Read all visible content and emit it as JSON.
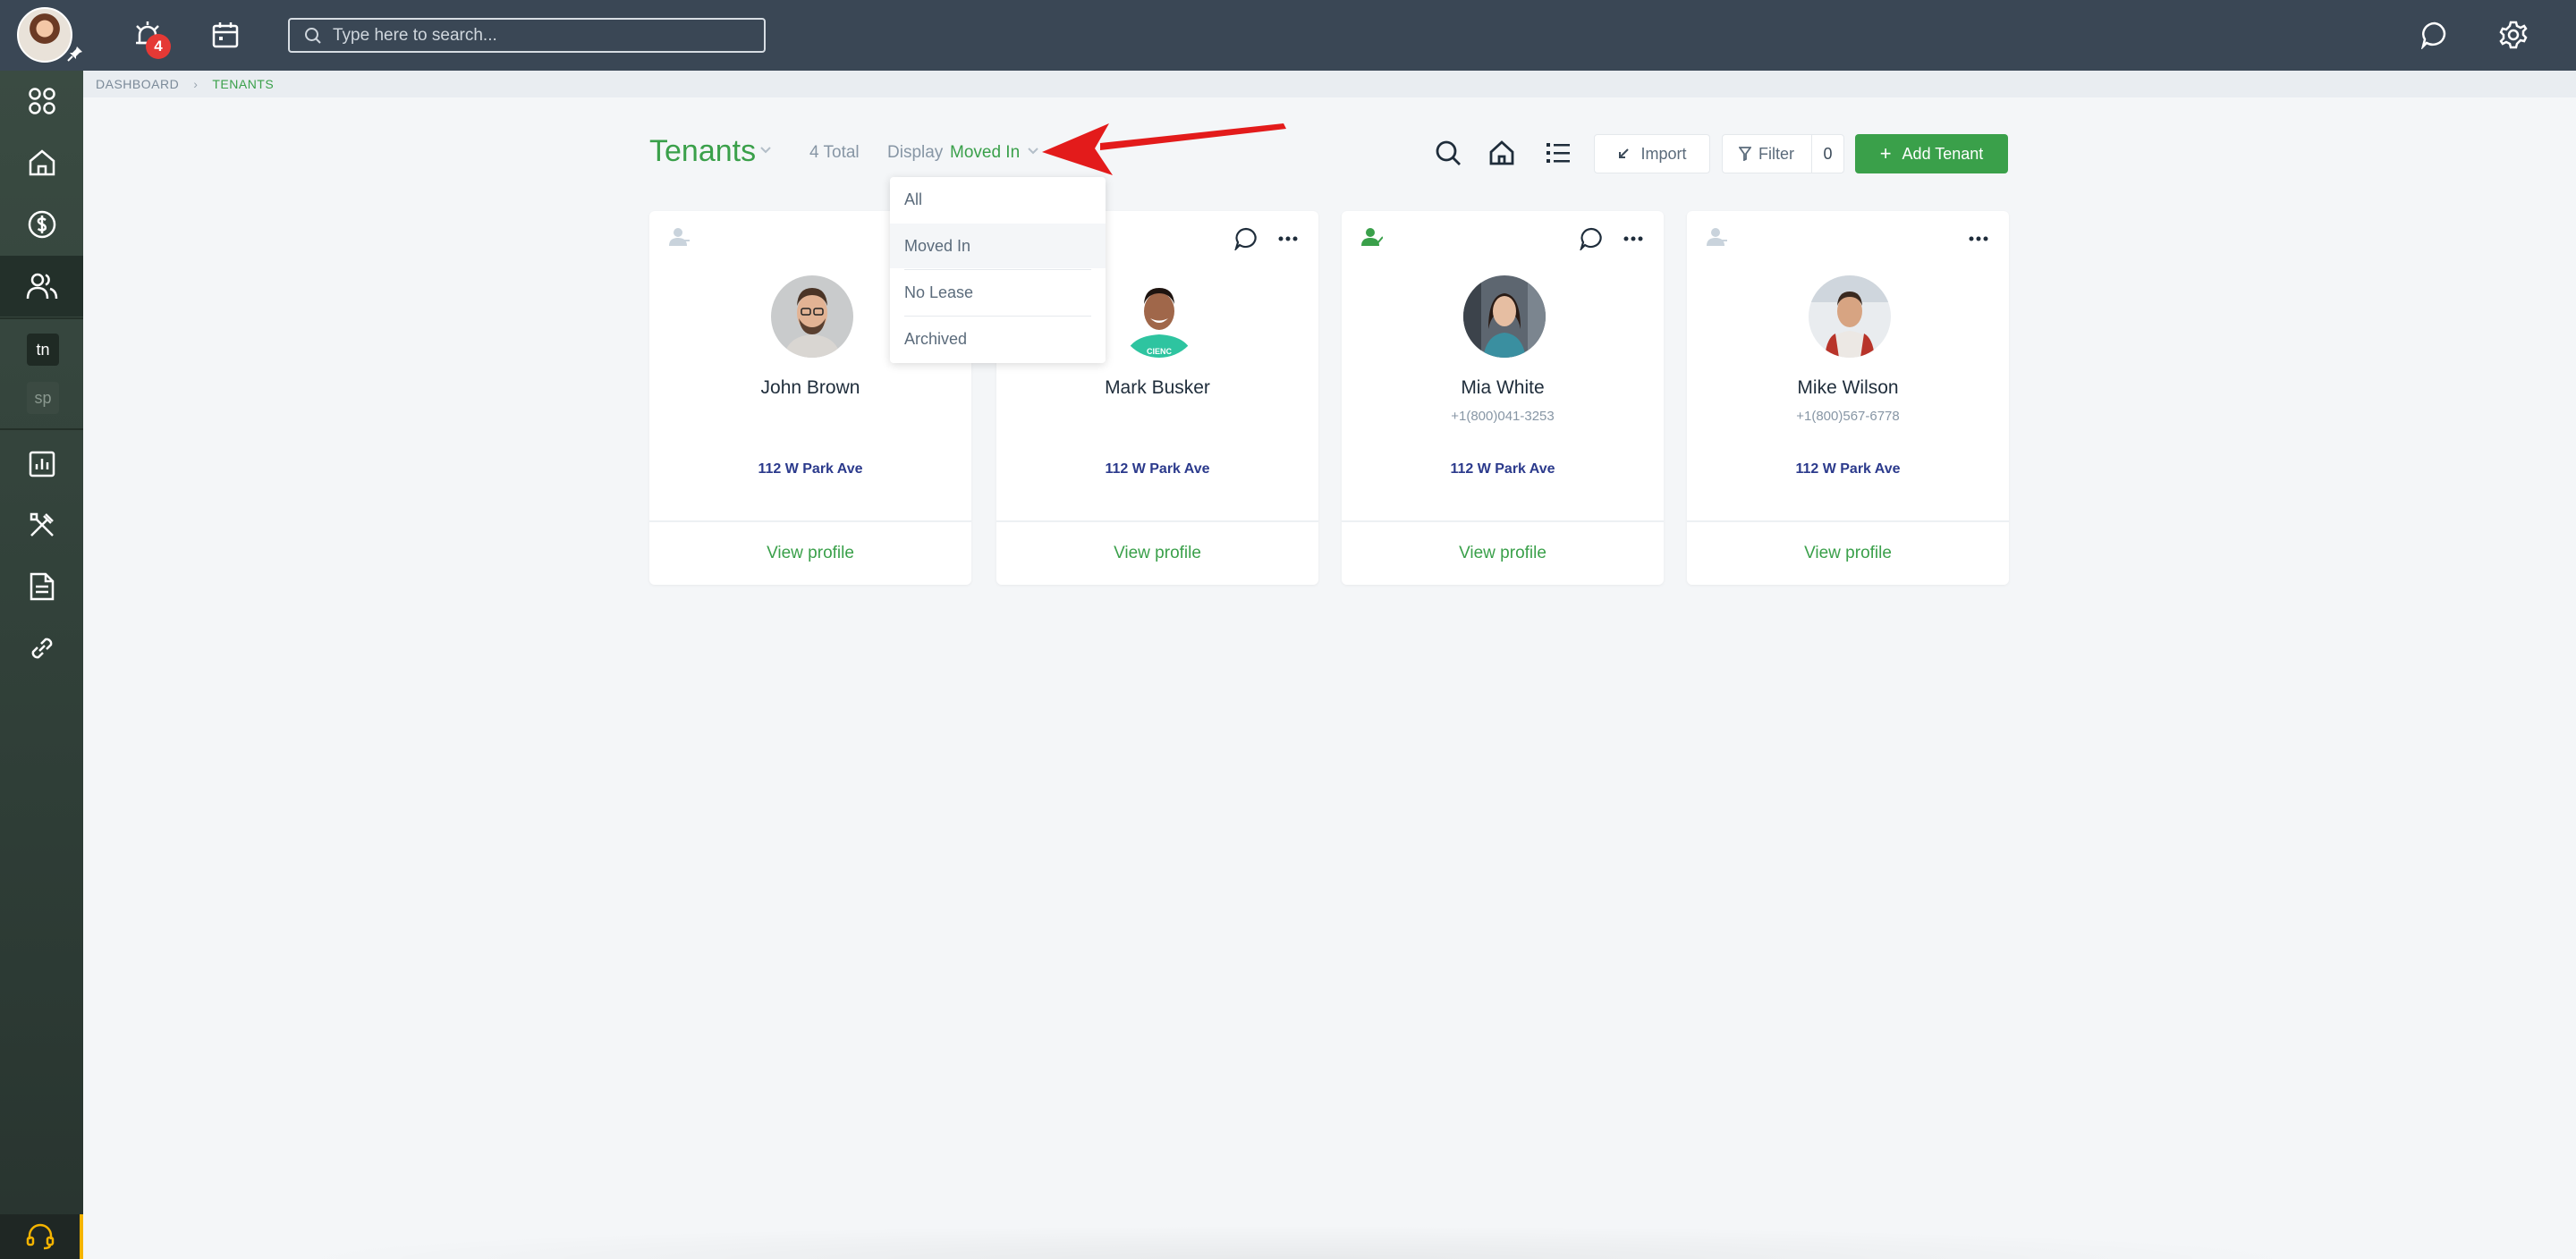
{
  "topbar": {
    "alarm_badge": "4",
    "search_placeholder": "Type here to search..."
  },
  "sidebar": {
    "chips": [
      {
        "label": "tn"
      },
      {
        "label": "sp"
      }
    ]
  },
  "breadcrumb": {
    "items": [
      "DASHBOARD",
      "TENANTS"
    ]
  },
  "header": {
    "title": "Tenants",
    "total": "4 Total",
    "display_label": "Display",
    "display_value": "Moved In",
    "import_label": "Import",
    "filter_label": "Filter",
    "filter_count": "0",
    "add_label": "Add Tenant"
  },
  "dropdown": {
    "options": [
      "All",
      "Moved In",
      "No Lease",
      "Archived"
    ],
    "selected": "Moved In"
  },
  "cards": [
    {
      "name": "John Brown",
      "phone": "",
      "address": "112 W Park Ave",
      "link": "View profile",
      "status_color": "#c9d3dc"
    },
    {
      "name": "Mark Busker",
      "phone": "",
      "address": "112 W Park Ave",
      "link": "View profile",
      "status_color": "#c9d3dc"
    },
    {
      "name": "Mia White",
      "phone": "+1(800)041-3253",
      "address": "112 W Park Ave",
      "link": "View profile",
      "status_color": "#3aa04a"
    },
    {
      "name": "Mike Wilson",
      "phone": "+1(800)567-6778",
      "address": "112 W Park Ave",
      "link": "View profile",
      "status_color": "#c9d3dc"
    }
  ],
  "colors": {
    "accent": "#3aa04a",
    "topbar": "#3a4755",
    "sidebar": "#2f3e37",
    "arrow": "#e31b1b"
  }
}
